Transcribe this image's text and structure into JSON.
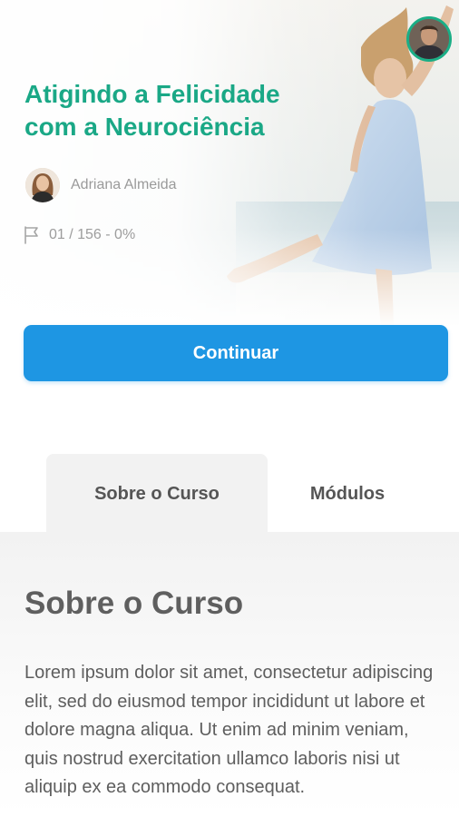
{
  "header": {
    "title_line1": "Atigindo a Felicidade",
    "title_line2": "com a Neurociência",
    "author_name": "Adriana Almeida",
    "progress_text": "01 / 156 - 0%"
  },
  "actions": {
    "continue_label": "Continuar"
  },
  "tabs": [
    {
      "label": "Sobre o Curso",
      "active": true
    },
    {
      "label": "Módulos",
      "active": false
    }
  ],
  "about": {
    "heading": "Sobre o Curso",
    "body": "Lorem ipsum dolor sit amet, consectetur adipiscing elit, sed do eiusmod tempor incididunt ut labore et dolore magna aliqua. Ut enim ad minim veniam, quis nostrud exercitation ullamco laboris nisi ut aliquip ex ea commodo consequat."
  },
  "icons": {
    "progress": "flag-icon",
    "profile": "user-avatar"
  },
  "colors": {
    "title": "#1aa886",
    "button": "#1e96e3",
    "avatar_ring": "#1aae86",
    "muted_text": "#9a9a9a"
  }
}
